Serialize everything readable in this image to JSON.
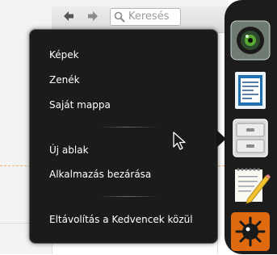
{
  "toolbar": {
    "back_icon": "arrow-left-icon",
    "forward_icon": "arrow-right-icon",
    "search_placeholder": "Keresés"
  },
  "menu": {
    "items": [
      {
        "label": "Képek"
      },
      {
        "label": "Zenék"
      },
      {
        "label": "Saját mappa"
      },
      {
        "label": "Új ablak"
      },
      {
        "label": "Alkalmazás bezárása"
      },
      {
        "label": "Eltávolítás a Kedvencek közül"
      }
    ]
  },
  "dock": {
    "items": [
      {
        "name": "camera-app-icon"
      },
      {
        "name": "writer-app-icon"
      },
      {
        "name": "file-manager-app-icon"
      },
      {
        "name": "text-editor-app-icon"
      },
      {
        "name": "game-app-icon"
      }
    ]
  },
  "colors": {
    "menu_bg": "#121212",
    "dock_bg": "#1c1c1c",
    "accent_orange": "#f5b36e"
  }
}
